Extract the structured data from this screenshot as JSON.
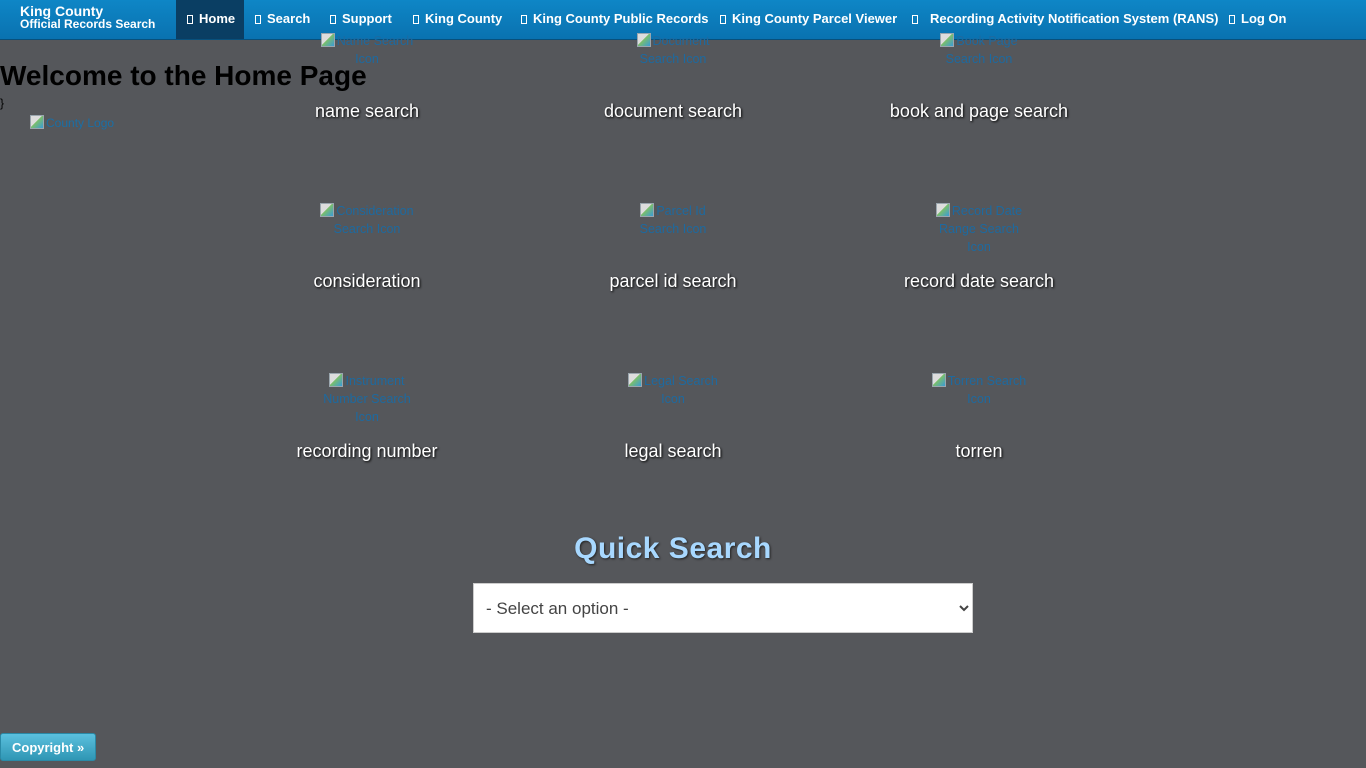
{
  "brand": {
    "line1": "King County",
    "line2": "Official Records Search"
  },
  "nav": {
    "items": [
      {
        "label": "Home",
        "icon": "home-icon",
        "active": true
      },
      {
        "label": "Search",
        "icon": "search-icon"
      },
      {
        "label": "Support",
        "icon": "support-icon"
      },
      {
        "label": "King County",
        "icon": "external-link-icon"
      },
      {
        "label": "King County Public Records",
        "icon": "external-link-icon"
      },
      {
        "label": "King County Parcel Viewer",
        "icon": "external-link-icon"
      },
      {
        "label": "Recording Activity Notification System (RANS)",
        "icon": "external-link-icon"
      },
      {
        "label": "Log On",
        "icon": "login-icon"
      }
    ]
  },
  "main": {
    "title": "Welcome to the Home Page",
    "stray_text": "}",
    "logo_alt": "County Logo"
  },
  "tiles": [
    {
      "icon_alt": "Name Search Icon",
      "label": "name search"
    },
    {
      "icon_alt": "Document Search Icon",
      "label": "document search"
    },
    {
      "icon_alt": "Book Page Search Icon",
      "label": "book and page search"
    },
    {
      "icon_alt": "Consideration Search Icon",
      "label": "consideration"
    },
    {
      "icon_alt": "Parcel Id Search Icon",
      "label": "parcel id search"
    },
    {
      "icon_alt": "Record Date Range Search Icon",
      "label": "record date search"
    },
    {
      "icon_alt": "Instrument Number Search Icon",
      "label": "recording number"
    },
    {
      "icon_alt": "Legal Search Icon",
      "label": "legal search"
    },
    {
      "icon_alt": "Torren Search Icon",
      "label": "torren"
    }
  ],
  "quick_search": {
    "title": "Quick Search",
    "select_value": "- Select an option -"
  },
  "footer": {
    "copyright_label": "Copyright »"
  },
  "colors": {
    "navbar": "#0a72b0",
    "active_nav": "#0a3e63",
    "background": "#55575b",
    "quick_title": "#a8d8ff",
    "copyright_btn": "#2f96b4"
  }
}
